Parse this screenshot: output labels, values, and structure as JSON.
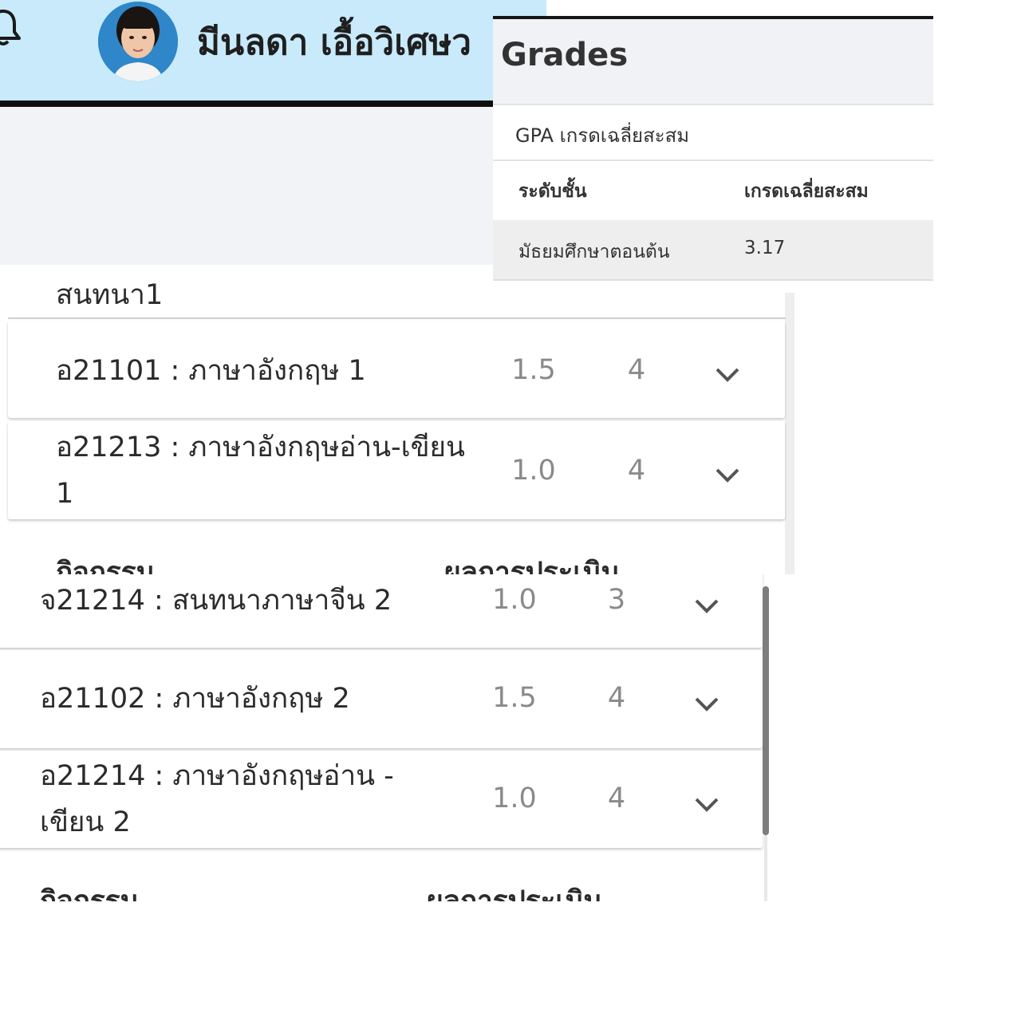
{
  "header": {
    "user_name": "มีนลดา เอื้อวิเศษว",
    "icons": {
      "notification": "bell-icon",
      "avatar": "student-photo"
    }
  },
  "grades_panel": {
    "title": "Grades",
    "gpa_label": "GPA เกรดเฉลี่ยสะสม",
    "columns": [
      "ระดับชั้น",
      "เกรดเฉลี่ยสะสม"
    ],
    "rows": [
      {
        "level": "มัธยมศึกษาตอนต้น",
        "gpa": "3.17"
      }
    ]
  },
  "list1": {
    "section_title": "สนทนา1",
    "courses": [
      {
        "name": "อ21101 : ภาษาอังกฤษ 1",
        "grade": "1.5",
        "credit": "4"
      },
      {
        "name_line1": "อ21213 : ภาษาอังกฤษอ่าน-เขียน",
        "name_line2": "1",
        "grade": "1.0",
        "credit": "4"
      }
    ],
    "activity_header": {
      "activity": "กิจกรรม",
      "result": "ผลการประเมิน"
    }
  },
  "list2": {
    "courses": [
      {
        "name": "จ21214 : สนทนาภาษาจีน 2",
        "grade": "1.0",
        "credit": "3"
      },
      {
        "name": "อ21102 : ภาษาอังกฤษ 2",
        "grade": "1.5",
        "credit": "4"
      },
      {
        "name_line1": "อ21214 : ภาษาอังกฤษอ่าน -",
        "name_line2": "เขียน 2",
        "grade": "1.0",
        "credit": "4"
      }
    ],
    "activity_header": {
      "activity": "กิจกรรม",
      "result": "ผลการประเมิน"
    }
  },
  "colors": {
    "header_bg": "#c8eafb",
    "header_rule": "#0e0e0e",
    "muted_text": "#8a8a8a",
    "panel_header_bg": "#f1f2f6",
    "gpa_row_bg": "#eeeeee"
  }
}
